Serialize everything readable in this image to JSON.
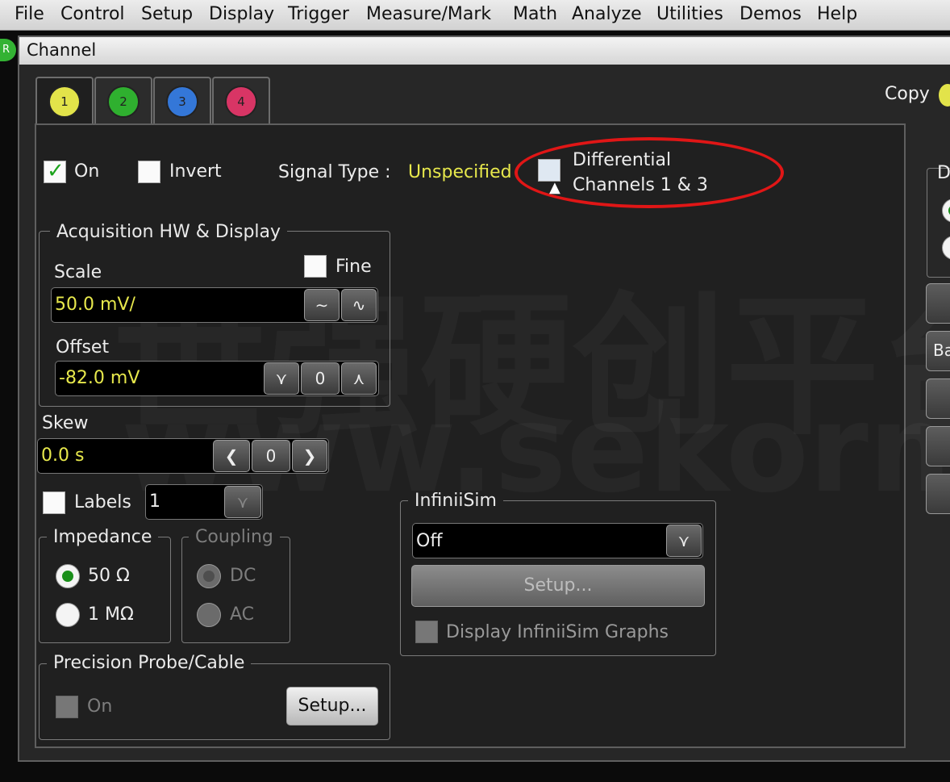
{
  "menu": [
    "File",
    "Control",
    "Setup",
    "Display",
    "Trigger",
    "Measure/Mark",
    "Math",
    "Analyze",
    "Utilities",
    "Demos",
    "Help"
  ],
  "status_led": "R",
  "dialog": {
    "title": "Channel",
    "copy_label": "Copy",
    "tabs": [
      {
        "label": "1",
        "color": "#e2e34a"
      },
      {
        "label": "2",
        "color": "#2fb02f"
      },
      {
        "label": "3",
        "color": "#3477d8"
      },
      {
        "label": "4",
        "color": "#d83565"
      }
    ]
  },
  "channel": {
    "on_label": "On",
    "invert_label": "Invert",
    "signal_type_label": "Signal Type :",
    "signal_type_value": "Unspecified",
    "differential_line1": "Differential",
    "differential_line2": "Channels 1 & 3"
  },
  "acquisition": {
    "title": "Acquisition HW & Display",
    "scale_label": "Scale",
    "fine_label": "Fine",
    "scale_value": "50.0 mV/",
    "offset_label": "Offset",
    "offset_value": "-82.0 mV"
  },
  "skew": {
    "label": "Skew",
    "value": "0.0 s"
  },
  "labels": {
    "label": "Labels",
    "value": "1"
  },
  "impedance": {
    "title": "Impedance",
    "opt1": "50 Ω",
    "opt2": "1 MΩ"
  },
  "coupling": {
    "title": "Coupling",
    "opt1": "DC",
    "opt2": "AC"
  },
  "probe": {
    "title": "Precision Probe/Cable",
    "on_label": "On",
    "setup_label": "Setup..."
  },
  "infiniisim": {
    "title": "InfiniiSim",
    "value": "Off",
    "setup_label": "Setup...",
    "graphs_label": "Display InfiniiSim Graphs"
  },
  "right_partial": {
    "group_letter": "D",
    "button_text": "Ba"
  },
  "watermark": {
    "line1": "世强硬创平台",
    "line2": "www.sekorm.com"
  }
}
